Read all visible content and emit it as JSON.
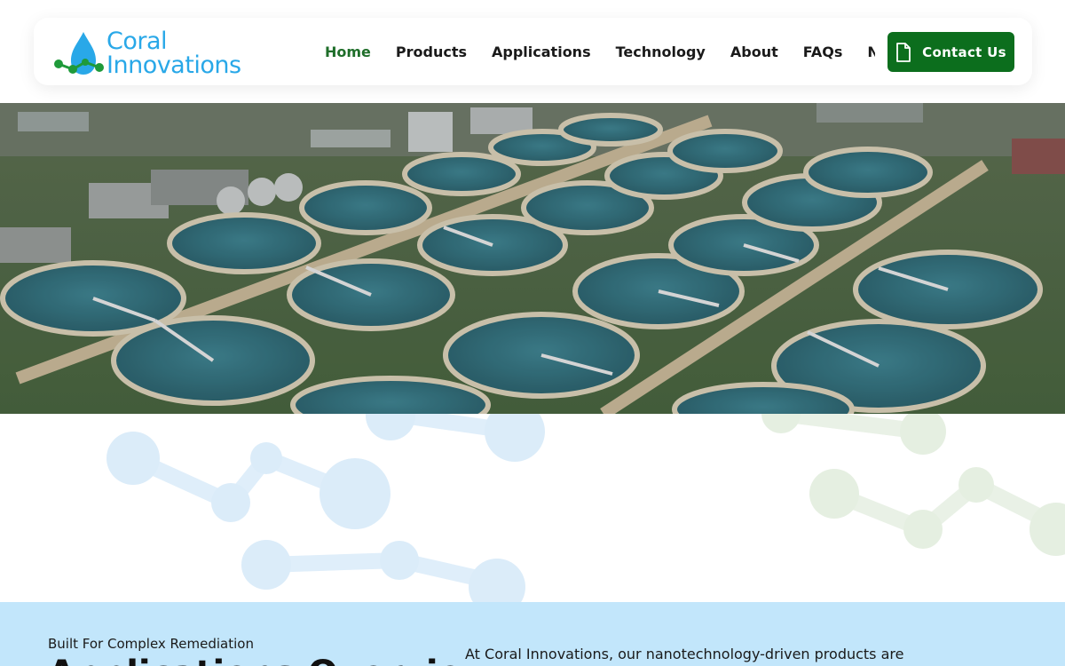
{
  "brand": {
    "line1": "Coral",
    "line2": "Innovations",
    "color": "#29a8e8",
    "accent_green": "#1f9a3a"
  },
  "nav": {
    "items": [
      {
        "label": "Home",
        "active": true
      },
      {
        "label": "Products",
        "active": false
      },
      {
        "label": "Applications",
        "active": false
      },
      {
        "label": "Technology",
        "active": false
      },
      {
        "label": "About",
        "active": false
      },
      {
        "label": "FAQs",
        "active": false
      },
      {
        "label": "News",
        "active": false
      }
    ],
    "active_color": "#1f6e2a"
  },
  "cta": {
    "label": "Contact Us",
    "icon": "document-icon",
    "color": "#0c6e1d"
  },
  "hero": {
    "image": "aerial view of water treatment plant with circular clarifier tanks"
  },
  "section": {
    "eyebrow": "Built For Complex Remediation",
    "title": "Applications Overview",
    "intro": "At Coral Innovations, our nanotechnology-driven products are",
    "background": "#c2e6fb"
  }
}
